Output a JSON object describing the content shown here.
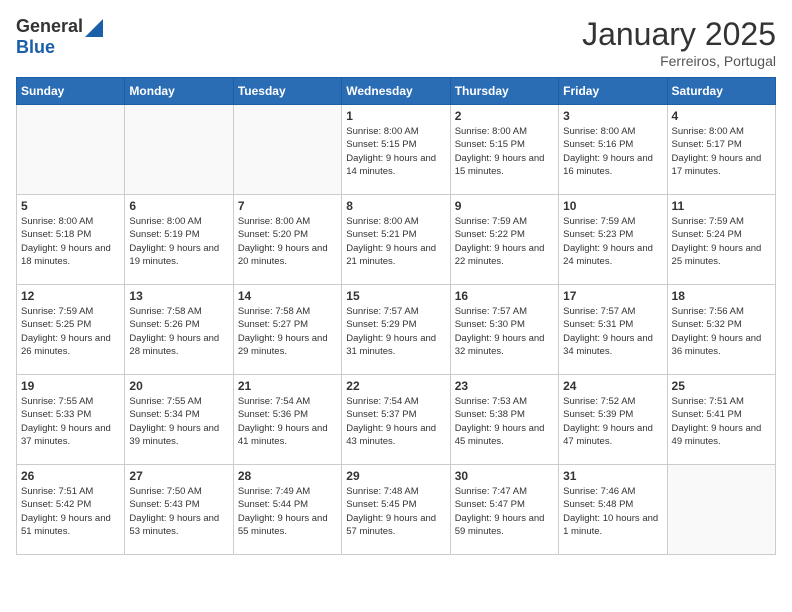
{
  "logo": {
    "general": "General",
    "blue": "Blue"
  },
  "header": {
    "month": "January 2025",
    "location": "Ferreiros, Portugal"
  },
  "weekdays": [
    "Sunday",
    "Monday",
    "Tuesday",
    "Wednesday",
    "Thursday",
    "Friday",
    "Saturday"
  ],
  "weeks": [
    [
      {
        "day": "",
        "empty": true
      },
      {
        "day": "",
        "empty": true
      },
      {
        "day": "",
        "empty": true
      },
      {
        "day": "1",
        "sunrise": "8:00 AM",
        "sunset": "5:15 PM",
        "daylight": "9 hours and 14 minutes."
      },
      {
        "day": "2",
        "sunrise": "8:00 AM",
        "sunset": "5:15 PM",
        "daylight": "9 hours and 15 minutes."
      },
      {
        "day": "3",
        "sunrise": "8:00 AM",
        "sunset": "5:16 PM",
        "daylight": "9 hours and 16 minutes."
      },
      {
        "day": "4",
        "sunrise": "8:00 AM",
        "sunset": "5:17 PM",
        "daylight": "9 hours and 17 minutes."
      }
    ],
    [
      {
        "day": "5",
        "sunrise": "8:00 AM",
        "sunset": "5:18 PM",
        "daylight": "9 hours and 18 minutes."
      },
      {
        "day": "6",
        "sunrise": "8:00 AM",
        "sunset": "5:19 PM",
        "daylight": "9 hours and 19 minutes."
      },
      {
        "day": "7",
        "sunrise": "8:00 AM",
        "sunset": "5:20 PM",
        "daylight": "9 hours and 20 minutes."
      },
      {
        "day": "8",
        "sunrise": "8:00 AM",
        "sunset": "5:21 PM",
        "daylight": "9 hours and 21 minutes."
      },
      {
        "day": "9",
        "sunrise": "7:59 AM",
        "sunset": "5:22 PM",
        "daylight": "9 hours and 22 minutes."
      },
      {
        "day": "10",
        "sunrise": "7:59 AM",
        "sunset": "5:23 PM",
        "daylight": "9 hours and 24 minutes."
      },
      {
        "day": "11",
        "sunrise": "7:59 AM",
        "sunset": "5:24 PM",
        "daylight": "9 hours and 25 minutes."
      }
    ],
    [
      {
        "day": "12",
        "sunrise": "7:59 AM",
        "sunset": "5:25 PM",
        "daylight": "9 hours and 26 minutes."
      },
      {
        "day": "13",
        "sunrise": "7:58 AM",
        "sunset": "5:26 PM",
        "daylight": "9 hours and 28 minutes."
      },
      {
        "day": "14",
        "sunrise": "7:58 AM",
        "sunset": "5:27 PM",
        "daylight": "9 hours and 29 minutes."
      },
      {
        "day": "15",
        "sunrise": "7:57 AM",
        "sunset": "5:29 PM",
        "daylight": "9 hours and 31 minutes."
      },
      {
        "day": "16",
        "sunrise": "7:57 AM",
        "sunset": "5:30 PM",
        "daylight": "9 hours and 32 minutes."
      },
      {
        "day": "17",
        "sunrise": "7:57 AM",
        "sunset": "5:31 PM",
        "daylight": "9 hours and 34 minutes."
      },
      {
        "day": "18",
        "sunrise": "7:56 AM",
        "sunset": "5:32 PM",
        "daylight": "9 hours and 36 minutes."
      }
    ],
    [
      {
        "day": "19",
        "sunrise": "7:55 AM",
        "sunset": "5:33 PM",
        "daylight": "9 hours and 37 minutes."
      },
      {
        "day": "20",
        "sunrise": "7:55 AM",
        "sunset": "5:34 PM",
        "daylight": "9 hours and 39 minutes."
      },
      {
        "day": "21",
        "sunrise": "7:54 AM",
        "sunset": "5:36 PM",
        "daylight": "9 hours and 41 minutes."
      },
      {
        "day": "22",
        "sunrise": "7:54 AM",
        "sunset": "5:37 PM",
        "daylight": "9 hours and 43 minutes."
      },
      {
        "day": "23",
        "sunrise": "7:53 AM",
        "sunset": "5:38 PM",
        "daylight": "9 hours and 45 minutes."
      },
      {
        "day": "24",
        "sunrise": "7:52 AM",
        "sunset": "5:39 PM",
        "daylight": "9 hours and 47 minutes."
      },
      {
        "day": "25",
        "sunrise": "7:51 AM",
        "sunset": "5:41 PM",
        "daylight": "9 hours and 49 minutes."
      }
    ],
    [
      {
        "day": "26",
        "sunrise": "7:51 AM",
        "sunset": "5:42 PM",
        "daylight": "9 hours and 51 minutes."
      },
      {
        "day": "27",
        "sunrise": "7:50 AM",
        "sunset": "5:43 PM",
        "daylight": "9 hours and 53 minutes."
      },
      {
        "day": "28",
        "sunrise": "7:49 AM",
        "sunset": "5:44 PM",
        "daylight": "9 hours and 55 minutes."
      },
      {
        "day": "29",
        "sunrise": "7:48 AM",
        "sunset": "5:45 PM",
        "daylight": "9 hours and 57 minutes."
      },
      {
        "day": "30",
        "sunrise": "7:47 AM",
        "sunset": "5:47 PM",
        "daylight": "9 hours and 59 minutes."
      },
      {
        "day": "31",
        "sunrise": "7:46 AM",
        "sunset": "5:48 PM",
        "daylight": "10 hours and 1 minute."
      },
      {
        "day": "",
        "empty": true
      }
    ]
  ]
}
